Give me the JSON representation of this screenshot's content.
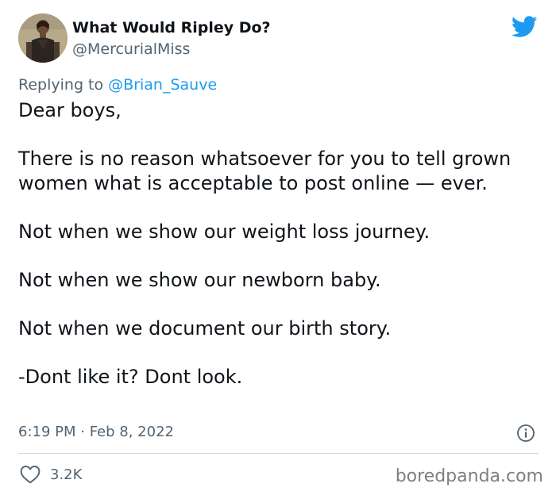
{
  "author": {
    "display_name": "What Would Ripley Do?",
    "handle": "@MercurialMiss",
    "avatar_icon": "profile-photo"
  },
  "reply": {
    "prefix": "Replying to ",
    "target": "@Brian_Sauve"
  },
  "tweet": {
    "paragraphs": [
      "Dear boys,",
      "There is no reason whatsoever for you to tell grown women what is acceptable to post online — ever.",
      "Not when we show our weight loss journey.",
      "Not when we show our newborn baby.",
      "Not when we document our birth story.",
      "-Dont like it? Dont look."
    ]
  },
  "meta": {
    "timestamp": "6:19 PM · Feb 8, 2022"
  },
  "actions": {
    "like_count": "3.2K"
  },
  "watermark": "boredpanda.com",
  "colors": {
    "accent": "#1d9bf0",
    "text": "#0f1419",
    "secondary": "#536471",
    "divider": "#cfd9de"
  }
}
